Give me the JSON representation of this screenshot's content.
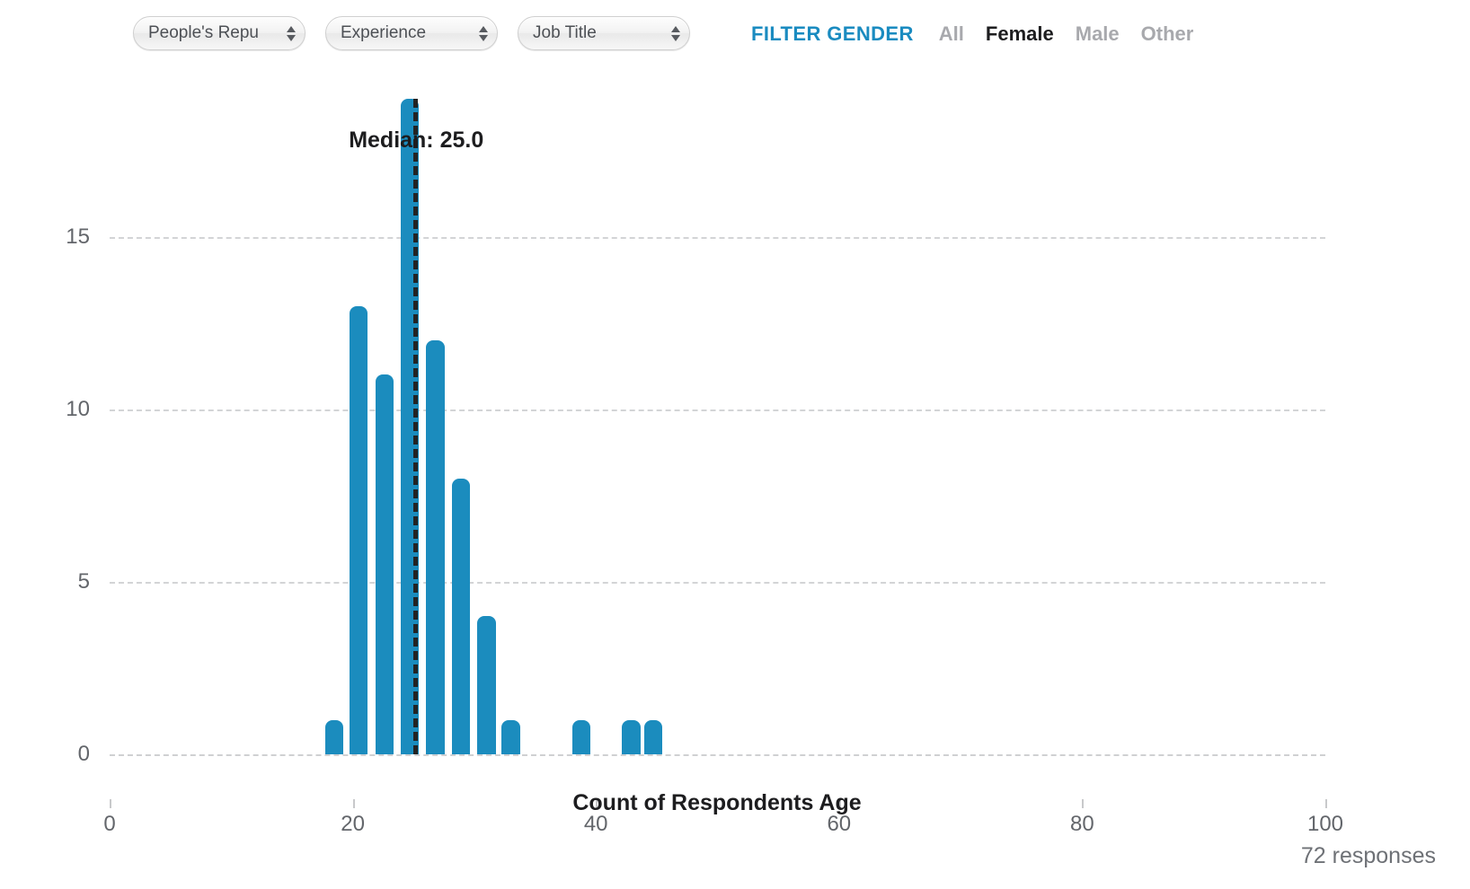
{
  "toolbar": {
    "selects": [
      {
        "name": "country-select",
        "value": "People's Repu"
      },
      {
        "name": "experience-select",
        "value": "Experience"
      },
      {
        "name": "job-title-select",
        "value": "Job Title"
      }
    ],
    "filter_gender_label": "FILTER GENDER",
    "gender_options": [
      {
        "label": "All",
        "selected": false
      },
      {
        "label": "Female",
        "selected": true
      },
      {
        "label": "Male",
        "selected": false
      },
      {
        "label": "Other",
        "selected": false
      }
    ]
  },
  "footer": {
    "responses": "72 responses"
  },
  "colors": {
    "bar": "#1b8cbe",
    "accent": "#1a8bc0",
    "grid": "#d3d4d6",
    "axis_text": "#63666b",
    "median": "#232323"
  },
  "chart_data": {
    "type": "bar",
    "title": "",
    "xlabel": "Count of Respondents Age",
    "ylabel": "",
    "xlim": [
      0,
      100
    ],
    "ylim": [
      0,
      19
    ],
    "xticks": [
      0,
      20,
      40,
      60,
      80,
      100
    ],
    "yticks": [
      0,
      5,
      10,
      15
    ],
    "grid": true,
    "legend": null,
    "annotations": [
      {
        "name": "median-marker",
        "label": "Median: 25.0",
        "value": 25.0
      }
    ],
    "note": "Histogram of respondent ages; bars keyed by age bin center (x) and count (y).",
    "x": [
      18.5,
      20.5,
      22.6,
      24.7,
      26.8,
      28.9,
      31.0,
      33.0,
      38.8,
      42.9,
      44.7
    ],
    "values": [
      1,
      13,
      11,
      19,
      12,
      8,
      4,
      1,
      1,
      1,
      1
    ],
    "bar_width_units": 1.5
  }
}
